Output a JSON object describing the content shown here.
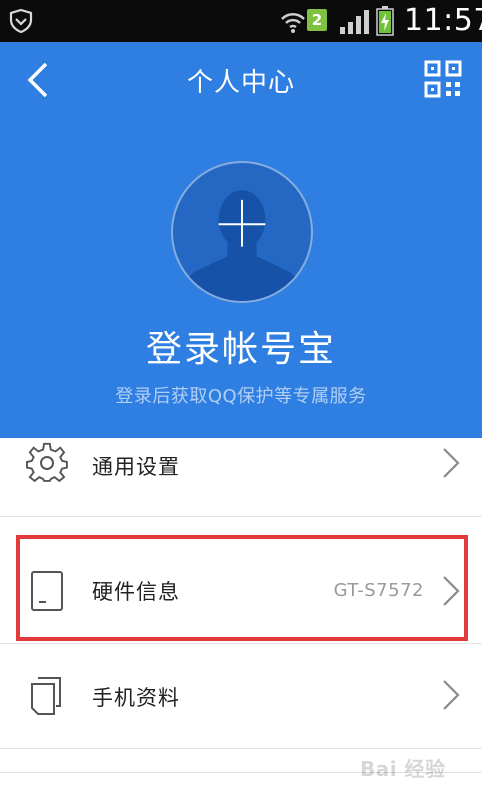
{
  "status_bar": {
    "sim_badge": "2",
    "time": "11:57",
    "icons": [
      "shield-icon",
      "wifi-icon",
      "signal-icon",
      "battery-charging-icon"
    ]
  },
  "header": {
    "title": "个人中心",
    "back_icon": "chevron-left-icon",
    "qr_icon": "qr-code-icon",
    "avatar_icon": "person-silhouette-icon",
    "login_title": "登录帐号宝",
    "login_subtitle": "登录后获取QQ保护等专属服务",
    "accent_color": "#2f7fe3"
  },
  "menu": [
    {
      "label": "通用设置",
      "value": "",
      "icon": "gear-icon"
    },
    {
      "label": "硬件信息",
      "value": "GT-S7572",
      "icon": "phone-device-icon"
    },
    {
      "label": "手机资料",
      "value": "",
      "icon": "documents-icon"
    }
  ],
  "highlight_color": "#e23a3a",
  "watermark": "Bai 经验"
}
